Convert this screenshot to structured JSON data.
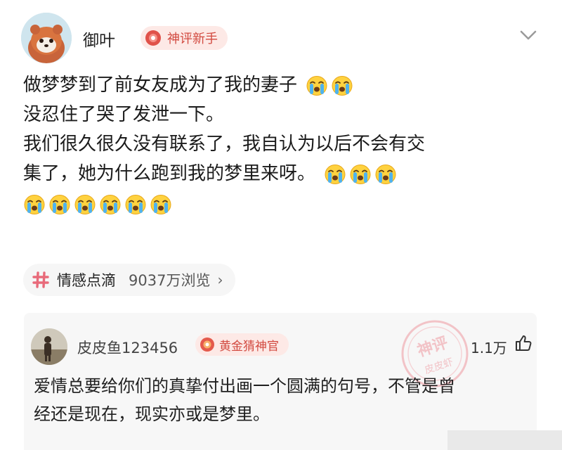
{
  "post": {
    "author_name": "御叶",
    "author_badge": "神评新手",
    "lines": [
      "做梦梦到了前女友成为了我的妻子",
      "没忍住了哭了发泄一下。",
      "我们很久很久没有联系了，我自认为以后不会有交",
      "集了，她为什么跑到我的梦里来呀。"
    ],
    "emoji_icon": "loudly-crying-face-icon",
    "emoji_counts": {
      "line1": 2,
      "line4": 3,
      "extra_line": 6
    }
  },
  "topic": {
    "name": "情感点滴",
    "views": "9037万浏览",
    "arrow": "›"
  },
  "comment": {
    "author_name": "皮皮鱼123456",
    "author_badge": "黄金猜神官",
    "likes": "1.1万",
    "lines": [
      "爱情总要给你们的真挚付出画一个圆满的句号，不管是曾",
      "经还是现在，现实亦或是梦里。"
    ],
    "watermark_lines": [
      "神评",
      "皮皮虾"
    ]
  },
  "colors": {
    "badge_bg": "#fde9e6",
    "badge_text": "#d24a40",
    "topic_hash": "#e86a7a",
    "comment_bg": "#f7f7f7"
  }
}
